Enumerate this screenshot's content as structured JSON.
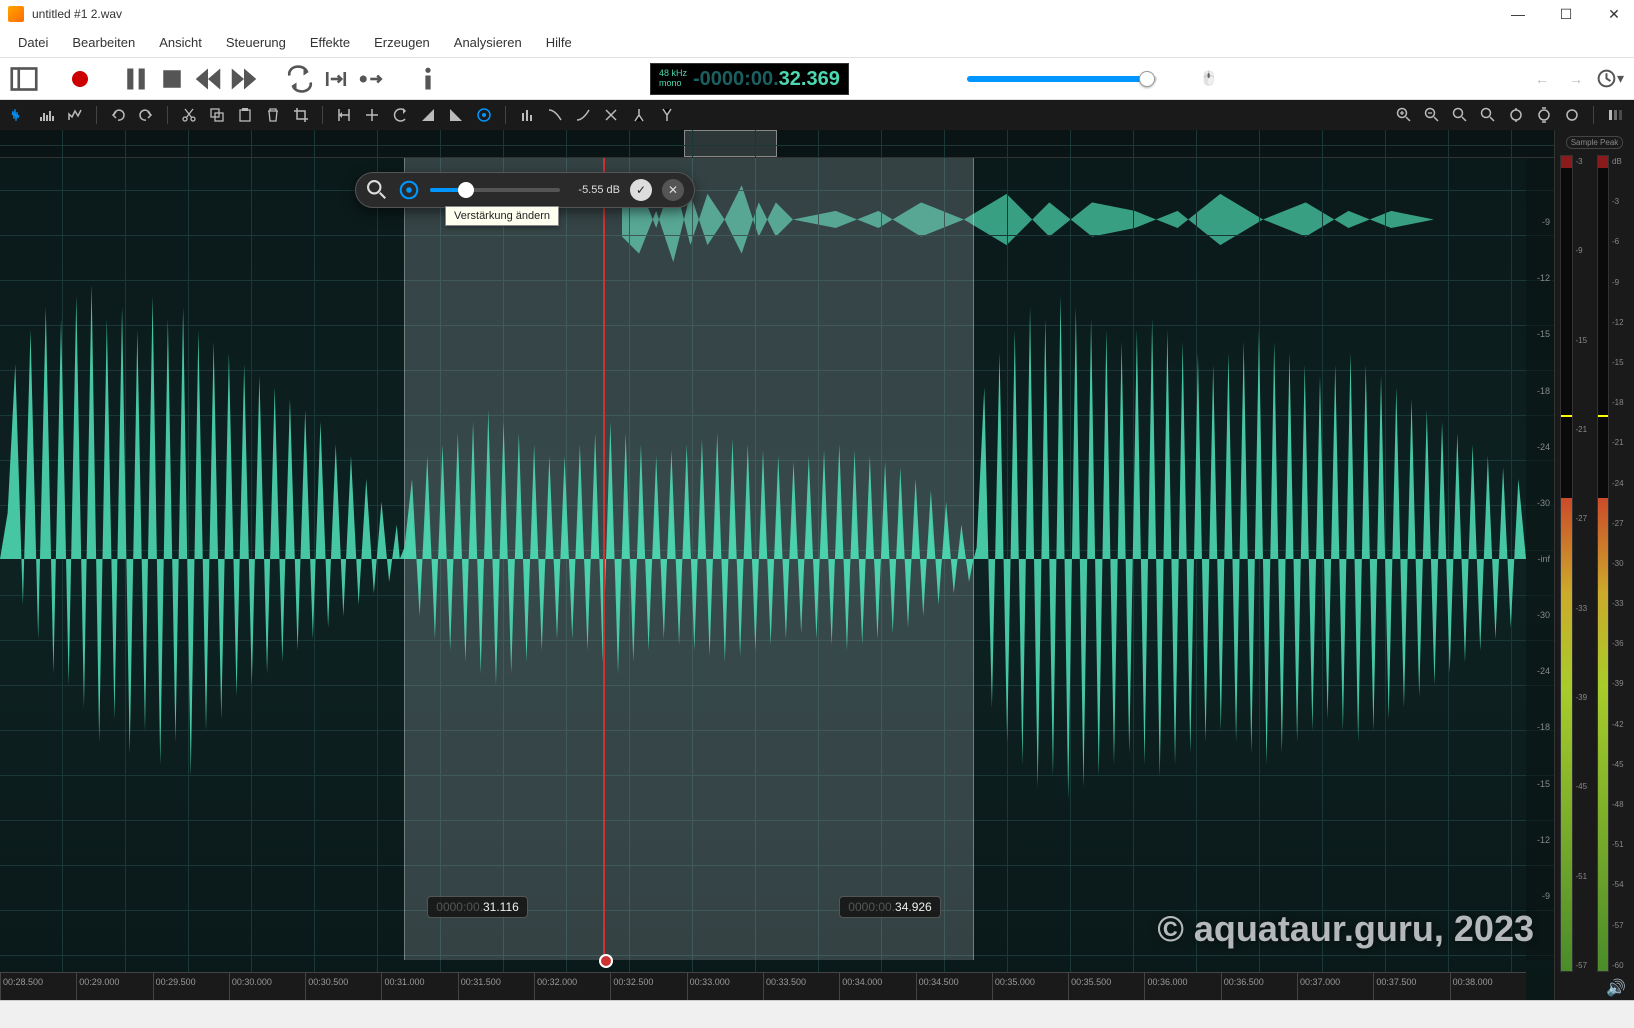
{
  "window": {
    "title": "untitled #1 2.wav"
  },
  "menu": {
    "items": [
      "Datei",
      "Bearbeiten",
      "Ansicht",
      "Steuerung",
      "Effekte",
      "Erzeugen",
      "Analysieren",
      "Hilfe"
    ]
  },
  "transport": {
    "sample_rate": "48 kHz",
    "channels": "mono",
    "timecode_dim": "-0000:00.",
    "timecode_bright": "32.369"
  },
  "volume_slider": {
    "percent": 95
  },
  "gain_tool": {
    "value_label": "-5.55 dB",
    "slider_percent": 28,
    "tooltip": "Verstärkung ändern"
  },
  "selection": {
    "start_pct": 26.5,
    "end_pct": 63.8,
    "playhead_pct": 39.5,
    "start_badge_dim": "0000:00.",
    "start_badge": "31.116",
    "end_badge_dim": "0000:00.",
    "end_badge": "34.926"
  },
  "overview": {
    "sel_left_pct": 44,
    "sel_width_pct": 6
  },
  "db_ticks": [
    "-9",
    "-12",
    "-15",
    "-18",
    "-24",
    "-30",
    "-inf",
    "-30",
    "-24",
    "-18",
    "-15",
    "-12",
    "-9"
  ],
  "time_ticks": [
    "00:28.500",
    "00:29.000",
    "00:29.500",
    "00:30.000",
    "00:30.500",
    "00:31.000",
    "00:31.500",
    "00:32.000",
    "00:32.500",
    "00:33.000",
    "00:33.500",
    "00:34.000",
    "00:34.500",
    "00:35.000",
    "00:35.500",
    "00:36.000",
    "00:36.500",
    "00:37.000",
    "00:37.500",
    "00:38.000"
  ],
  "meter": {
    "header": "Sample Peak",
    "unit": "dB",
    "scale_l": [
      "-3",
      "-9",
      "-15",
      "-21",
      "-27",
      "-33",
      "-39",
      "-45",
      "-51",
      "-57"
    ],
    "scale_r": [
      "dB",
      "-3",
      "-6",
      "-9",
      "-12",
      "-15",
      "-18",
      "-21",
      "-24",
      "-27",
      "-30",
      "-33",
      "-36",
      "-39",
      "-42",
      "-45",
      "-48",
      "-51",
      "-54",
      "-57",
      "-60"
    ],
    "bar1_fill_pct": 58,
    "bar1_peak_pct": 68,
    "bar2_fill_pct": 58,
    "bar2_peak_pct": 68
  },
  "watermark": "© aquataur.guru, 2023"
}
